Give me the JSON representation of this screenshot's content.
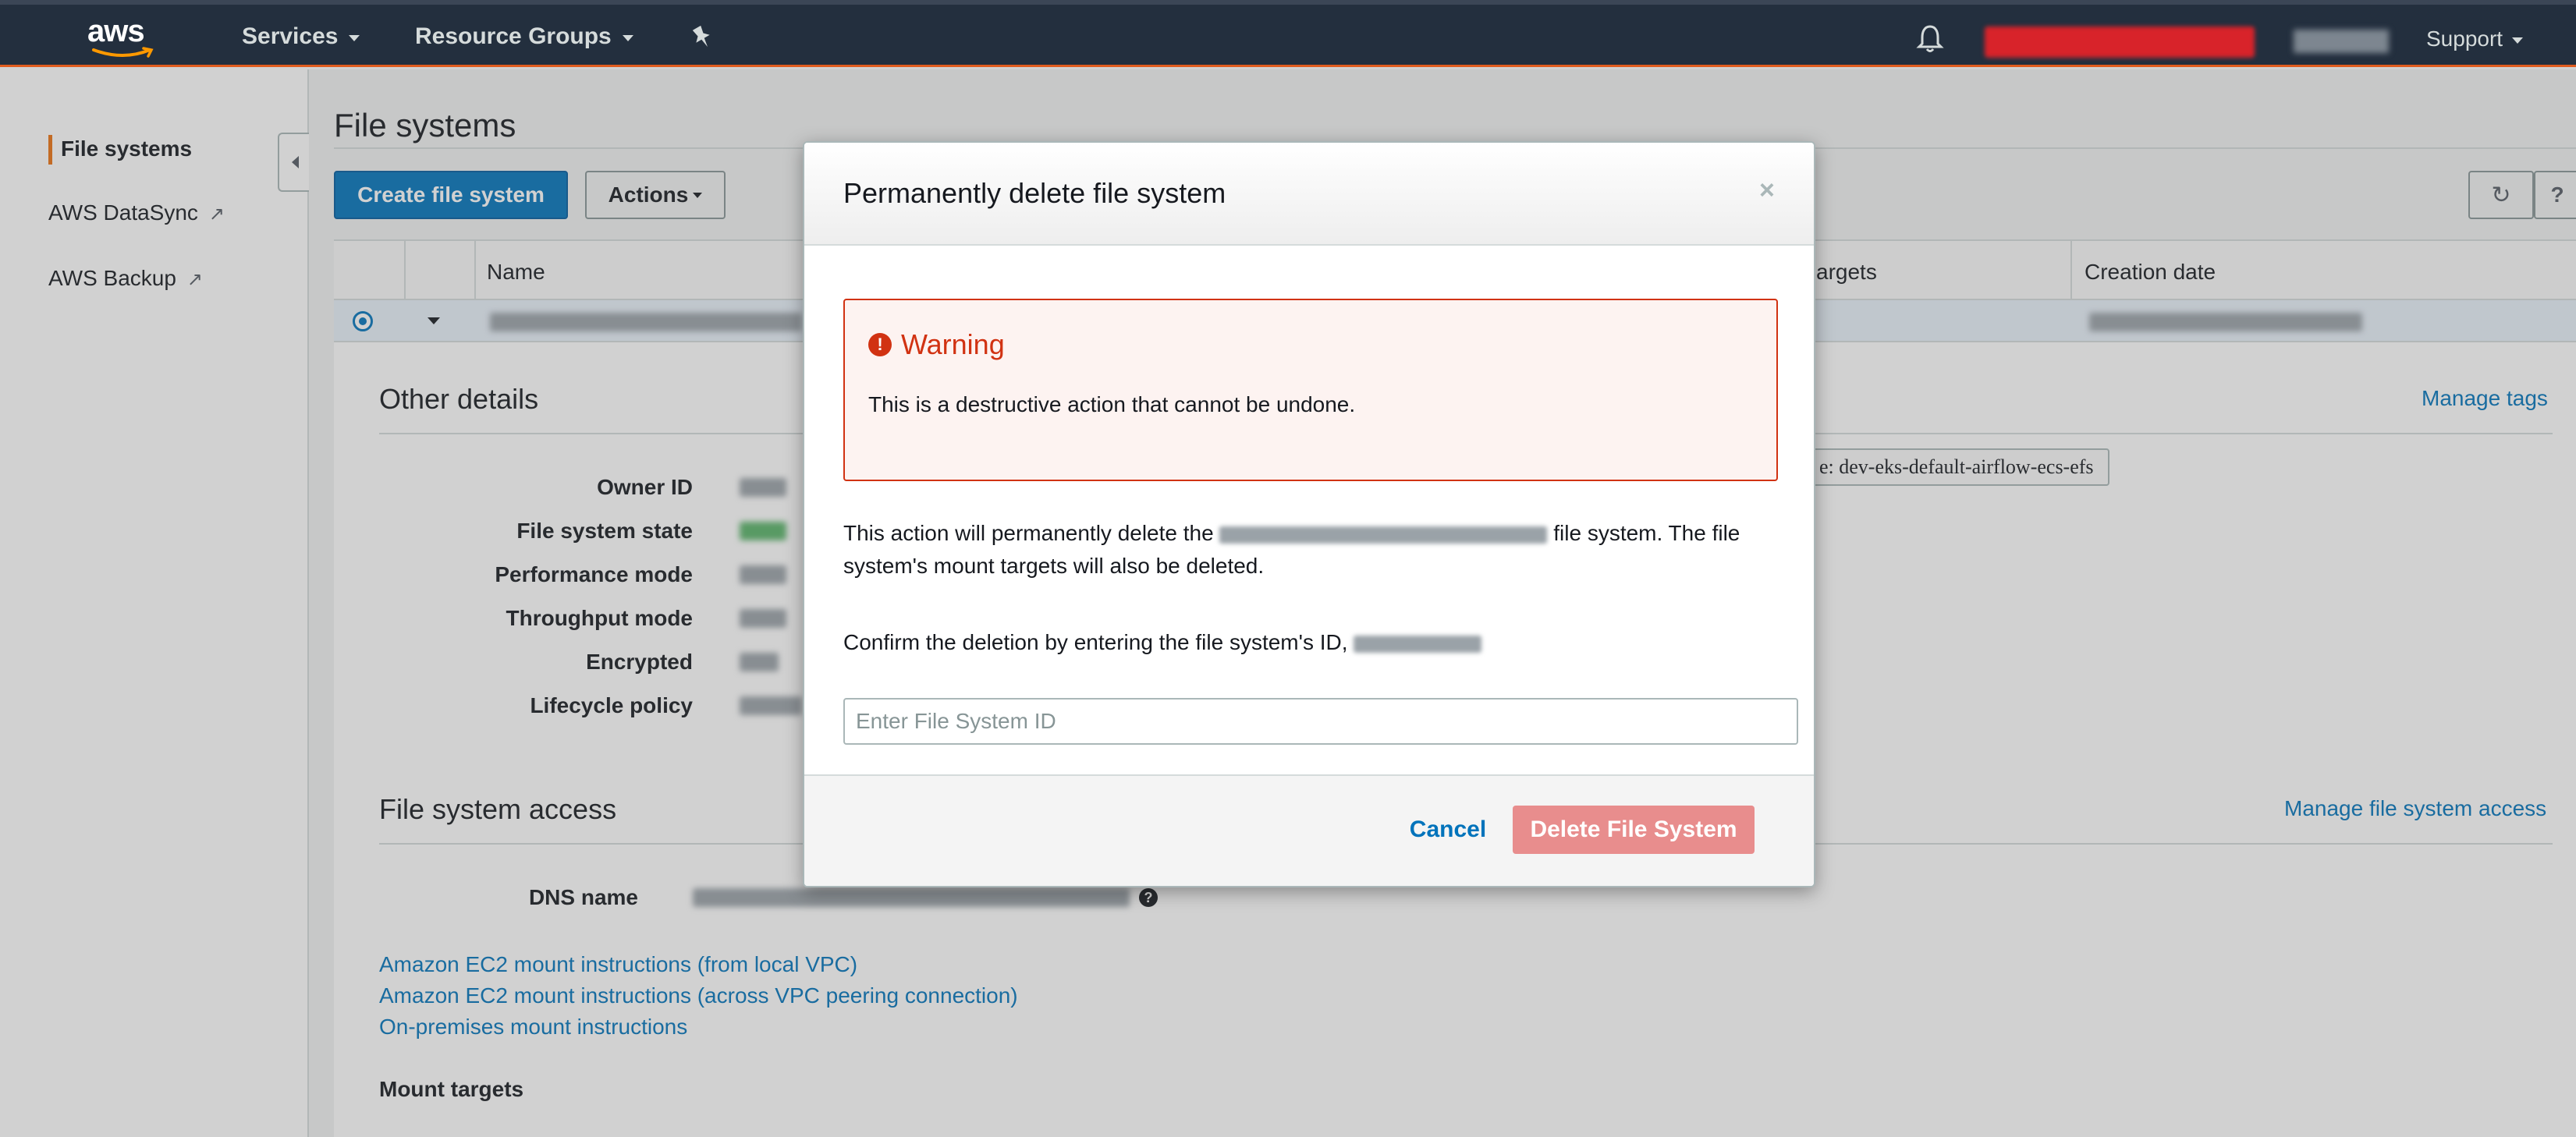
{
  "topnav": {
    "logo_text": "aws",
    "services": "Services",
    "resource_groups": "Resource Groups",
    "support": "Support"
  },
  "sidebar": {
    "items": [
      {
        "label": "File systems",
        "active": true
      },
      {
        "label": "AWS DataSync",
        "external": true
      },
      {
        "label": "AWS Backup",
        "external": true
      }
    ]
  },
  "main": {
    "page_title": "File systems",
    "create_button": "Create file system",
    "actions_button": "Actions",
    "table": {
      "columns": [
        "Name",
        "argets",
        "Creation date"
      ]
    },
    "details": {
      "other_details_title": "Other details",
      "manage_tags": "Manage tags",
      "tag_value": "e: dev-eks-default-airflow-ecs-efs",
      "labels": [
        "Owner ID",
        "File system state",
        "Performance mode",
        "Throughput mode",
        "Encrypted",
        "Lifecycle policy"
      ],
      "access_title": "File system access",
      "manage_access": "Manage file system access",
      "dns_label": "DNS name",
      "links": [
        "Amazon EC2 mount instructions (from local VPC)",
        "Amazon EC2 mount instructions (across VPC peering connection)",
        "On-premises mount instructions"
      ],
      "mount_targets": "Mount targets"
    }
  },
  "modal": {
    "title": "Permanently delete file system",
    "close": "×",
    "warning_title": "Warning",
    "warning_body": "This is a destructive action that cannot be undone.",
    "para1_prefix": "This action will permanently delete the",
    "para1_suffix": "file system. The file system's mount targets will also be deleted.",
    "confirm_text": "Confirm the deletion by entering the file system's ID,",
    "input_placeholder": "Enter File System ID",
    "cancel": "Cancel",
    "delete": "Delete File System"
  },
  "colors": {
    "nav_bg": "#232f3e",
    "accent_orange": "#ec7211",
    "link_blue": "#0073bb",
    "danger_red": "#d13212",
    "delete_disabled": "#e88d8d"
  }
}
